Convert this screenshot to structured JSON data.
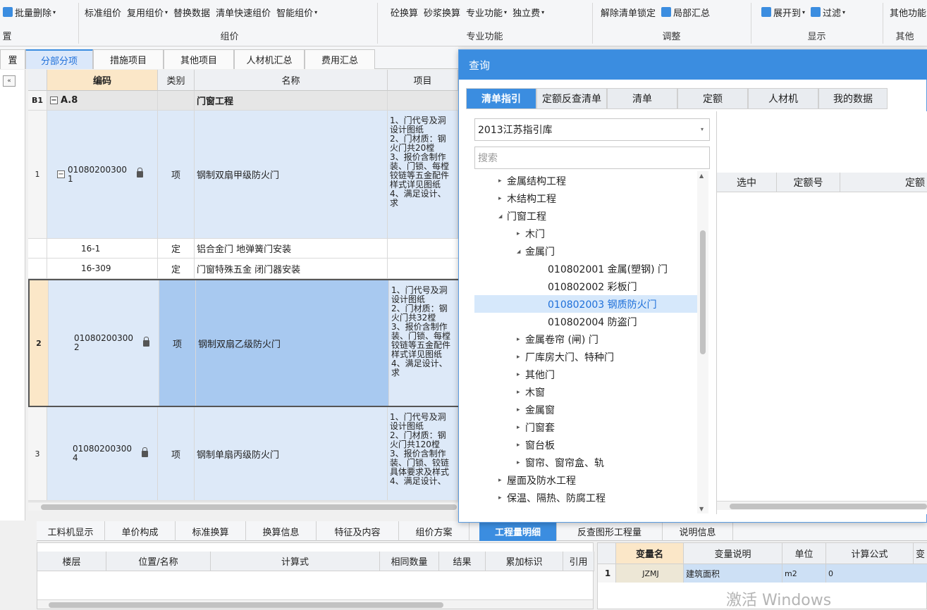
{
  "ribbon": {
    "items": [
      {
        "label": "批量删除",
        "caret": "▾",
        "icon": "batch-delete-icon",
        "color": "#3b8de0"
      },
      {
        "label": "标准组价"
      },
      {
        "label": "复用组价",
        "caret": "▾"
      },
      {
        "label": "替换数据"
      },
      {
        "label": "清单快速组价"
      },
      {
        "label": "智能组价",
        "caret": "▾"
      },
      {
        "label": "砼换算"
      },
      {
        "label": "砂浆换算"
      },
      {
        "label": "专业功能",
        "caret": "▾"
      },
      {
        "label": "独立费",
        "caret": "▾"
      },
      {
        "label": "解除清单锁定"
      },
      {
        "label": "局部汇总",
        "icon": "summary-icon",
        "color": "#3b8de0"
      },
      {
        "label": "展开到",
        "caret": "▾",
        "icon": "expand-icon",
        "color": "#3b8de0"
      },
      {
        "label": "过滤",
        "caret": "▾",
        "icon": "filter-icon",
        "color": "#3b8de0"
      },
      {
        "label": "其他功能"
      }
    ],
    "groups": [
      "组价",
      "专业功能",
      "调整",
      "显示",
      "其他"
    ],
    "left_cut": "置"
  },
  "top_tabs": [
    "分部分项",
    "措施项目",
    "其他项目",
    "人材机汇总",
    "费用汇总"
  ],
  "grid": {
    "headers": [
      "编码",
      "类别",
      "名称",
      "项目"
    ],
    "section": {
      "num": "B1",
      "toggle": "−",
      "code": "A.8",
      "name": "门窗工程"
    },
    "rows": [
      {
        "num": "1",
        "toggle": "−",
        "code": "01080200300\n1",
        "type": "项",
        "name": "钢制双扇甲级防火门",
        "desc": "1、门代号及洞\n设计图纸\n2、门材质：钢\n火门共20樘\n3、报价含制作\n装、门锁、每樘\n铰链等五金配件\n样式详见图纸\n4、满足设计、\n求"
      },
      {
        "num": "",
        "code": "16-1",
        "type": "定",
        "name": "铝合金门 地弹簧门安装",
        "desc": ""
      },
      {
        "num": "",
        "code": "16-309",
        "type": "定",
        "name": "门窗特殊五金 闭门器安装",
        "desc": ""
      },
      {
        "num": "2",
        "code": "01080200300\n2",
        "type": "项",
        "name": "钢制双扇乙级防火门",
        "desc": "1、门代号及洞\n设计图纸\n2、门材质：钢\n火门共32樘\n3、报价含制作\n装、门锁、每樘\n铰链等五金配件\n样式详见图纸\n4、满足设计、\n求"
      },
      {
        "num": "3",
        "code": "01080200300\n4",
        "type": "项",
        "name": "钢制单扇丙级防火门",
        "desc": "1、门代号及洞\n设计图纸\n2、门材质：钢\n火门共120樘\n3、报价含制作\n装、门锁、铰链\n具体要求及样式\n4、满足设计、"
      }
    ]
  },
  "bottom_tabs": [
    "工料机显示",
    "单价构成",
    "标准换算",
    "换算信息",
    "特征及内容",
    "组价方案",
    "工程量明细",
    "反查图形工程量",
    "说明信息"
  ],
  "qty_headers": [
    "楼层",
    "位置/名称",
    "计算式",
    "相同数量",
    "结果",
    "累加标识",
    "引用"
  ],
  "var_table": {
    "headers": [
      "变量名",
      "变量说明",
      "单位",
      "计算公式",
      "变"
    ],
    "row": {
      "num": "1",
      "name": "JZMJ",
      "desc": "建筑面积",
      "unit": "m2",
      "formula": "0"
    }
  },
  "dialog": {
    "title": "查询",
    "tabs": [
      "清单指引",
      "定额反查清单",
      "清单",
      "定额",
      "人材机",
      "我的数据"
    ],
    "library": "2013江苏指引库",
    "search_placeholder": "搜索",
    "tree": [
      {
        "label": "金属结构工程",
        "level": 1,
        "arrow": "▸"
      },
      {
        "label": "木结构工程",
        "level": 1,
        "arrow": "▸"
      },
      {
        "label": "门窗工程",
        "level": 1,
        "arrow": "◢"
      },
      {
        "label": "木门",
        "level": 2,
        "arrow": "▸"
      },
      {
        "label": "金属门",
        "level": 2,
        "arrow": "◢"
      },
      {
        "label": "010802001  金属(塑钢) 门",
        "level": 3,
        "arrow": ""
      },
      {
        "label": "010802002  彩板门",
        "level": 3,
        "arrow": ""
      },
      {
        "label": "010802003  钢质防火门",
        "level": 3,
        "arrow": "",
        "selected": true
      },
      {
        "label": "010802004  防盗门",
        "level": 3,
        "arrow": ""
      },
      {
        "label": "金属卷帘 (闸) 门",
        "level": 2,
        "arrow": "▸"
      },
      {
        "label": "厂库房大门、特种门",
        "level": 2,
        "arrow": "▸"
      },
      {
        "label": "其他门",
        "level": 2,
        "arrow": "▸"
      },
      {
        "label": "木窗",
        "level": 2,
        "arrow": "▸"
      },
      {
        "label": "金属窗",
        "level": 2,
        "arrow": "▸"
      },
      {
        "label": "门窗套",
        "level": 2,
        "arrow": "▸"
      },
      {
        "label": "窗台板",
        "level": 2,
        "arrow": "▸"
      },
      {
        "label": "窗帘、窗帘盒、轨",
        "level": 2,
        "arrow": "▸"
      },
      {
        "label": "屋面及防水工程",
        "level": 1,
        "arrow": "▸"
      },
      {
        "label": "保温、隔热、防腐工程",
        "level": 1,
        "arrow": "▸"
      }
    ],
    "right_headers": [
      "选中",
      "定额号",
      "定额"
    ]
  },
  "watermark": "激活 Windows",
  "colors": {
    "accent": "#3b8de0",
    "highlight": "#fbe7c8",
    "selection": "#a8c9f0"
  }
}
